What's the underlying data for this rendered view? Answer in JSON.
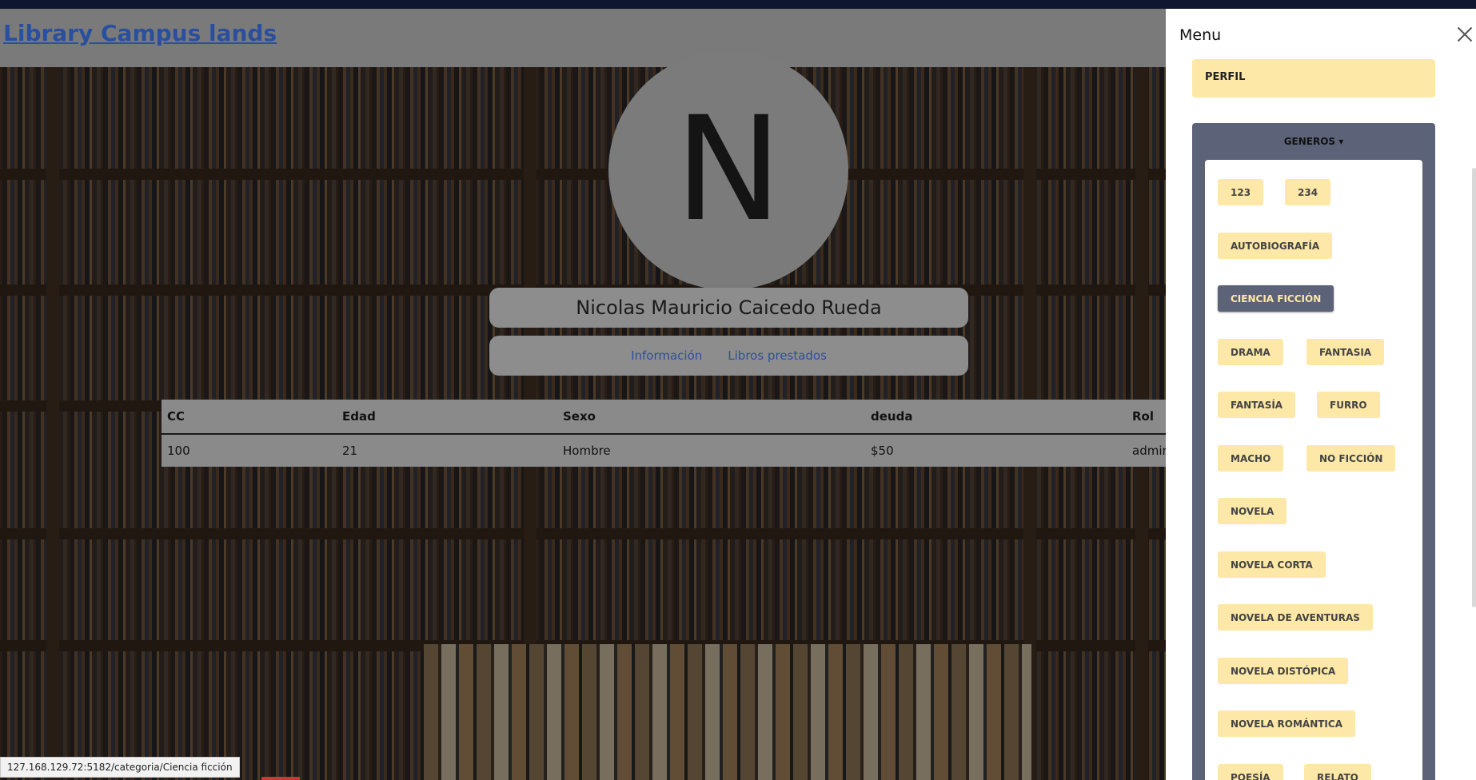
{
  "header": {
    "brand": "Library Campus lands"
  },
  "profile": {
    "avatar_letter": "N",
    "name": "Nicolas Mauricio Caicedo Rueda",
    "links": [
      "Información",
      "Libros prestados"
    ]
  },
  "user_table": {
    "columns": [
      "CC",
      "Edad",
      "Sexo",
      "deuda",
      "Rol"
    ],
    "row": [
      "100",
      "21",
      "Hombre",
      "$50",
      "admin"
    ]
  },
  "menu": {
    "title": "Menu",
    "perfil_label": "PERFIL",
    "genres_label": "GENEROS ▾",
    "selected_genre": "CIENCIA FICCIÓN",
    "genres": [
      "123",
      "234",
      "AUTOBIOGRAFÍA",
      "CIENCIA FICCIÓN",
      "DRAMA",
      "FANTASIA",
      "FANTASÍA",
      "FURRO",
      "MACHO",
      "NO FICCIÓN",
      "NOVELA",
      "NOVELA CORTA",
      "NOVELA DE AVENTURAS",
      "NOVELA DISTÓPICA",
      "NOVELA ROMÁNTICA",
      "POESÍA",
      "RELATO"
    ]
  },
  "status_bar": {
    "url": "127.168.129.72:5182/categoria/Ciencia ficción"
  },
  "colors": {
    "accent_yellow": "#fde8a7",
    "slate": "#5c6378",
    "link_blue": "#2f4f9a"
  }
}
